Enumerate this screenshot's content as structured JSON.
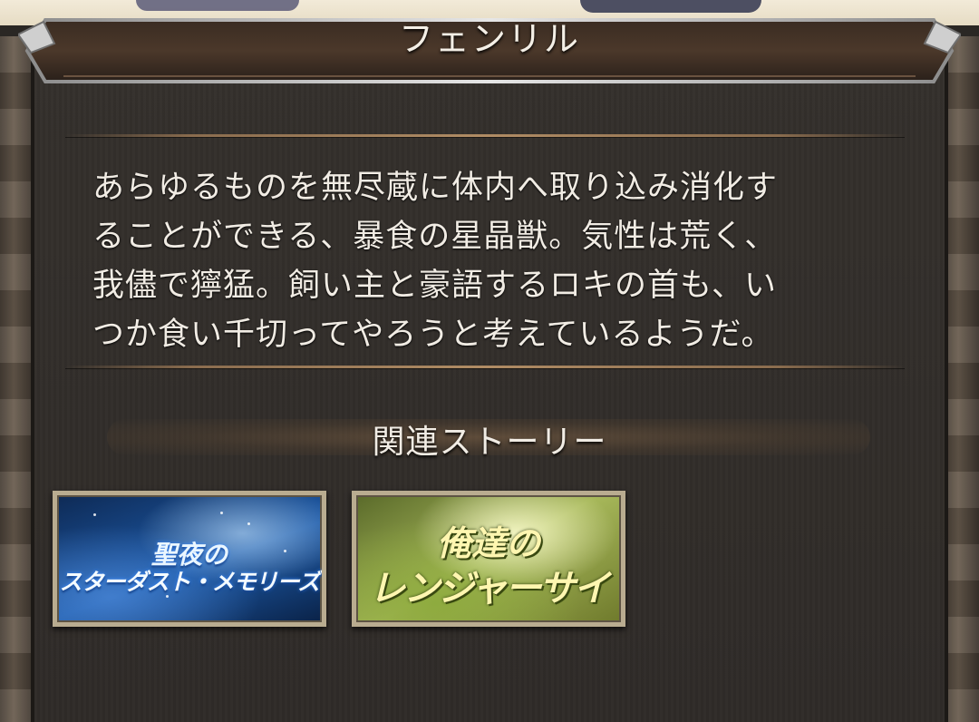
{
  "header": {
    "title": "フェンリル"
  },
  "description": {
    "lines": [
      "あらゆるものを無尽蔵に体内へ取り込み消化す",
      "ることができる、暴食の星晶獣。気性は荒く、",
      "我儘で獰猛。飼い主と豪語するロキの首も、い",
      "つか食い千切ってやろうと考えているようだ。"
    ]
  },
  "related_stories": {
    "heading": "関連ストーリー",
    "cards": [
      {
        "line1": "聖夜の",
        "line2": "スターダスト・メモリーズ",
        "accent": "#1d5aa8"
      },
      {
        "line1": "俺達の",
        "line2": "レンジャーサイン!",
        "accent": "#a7b85a"
      }
    ]
  }
}
